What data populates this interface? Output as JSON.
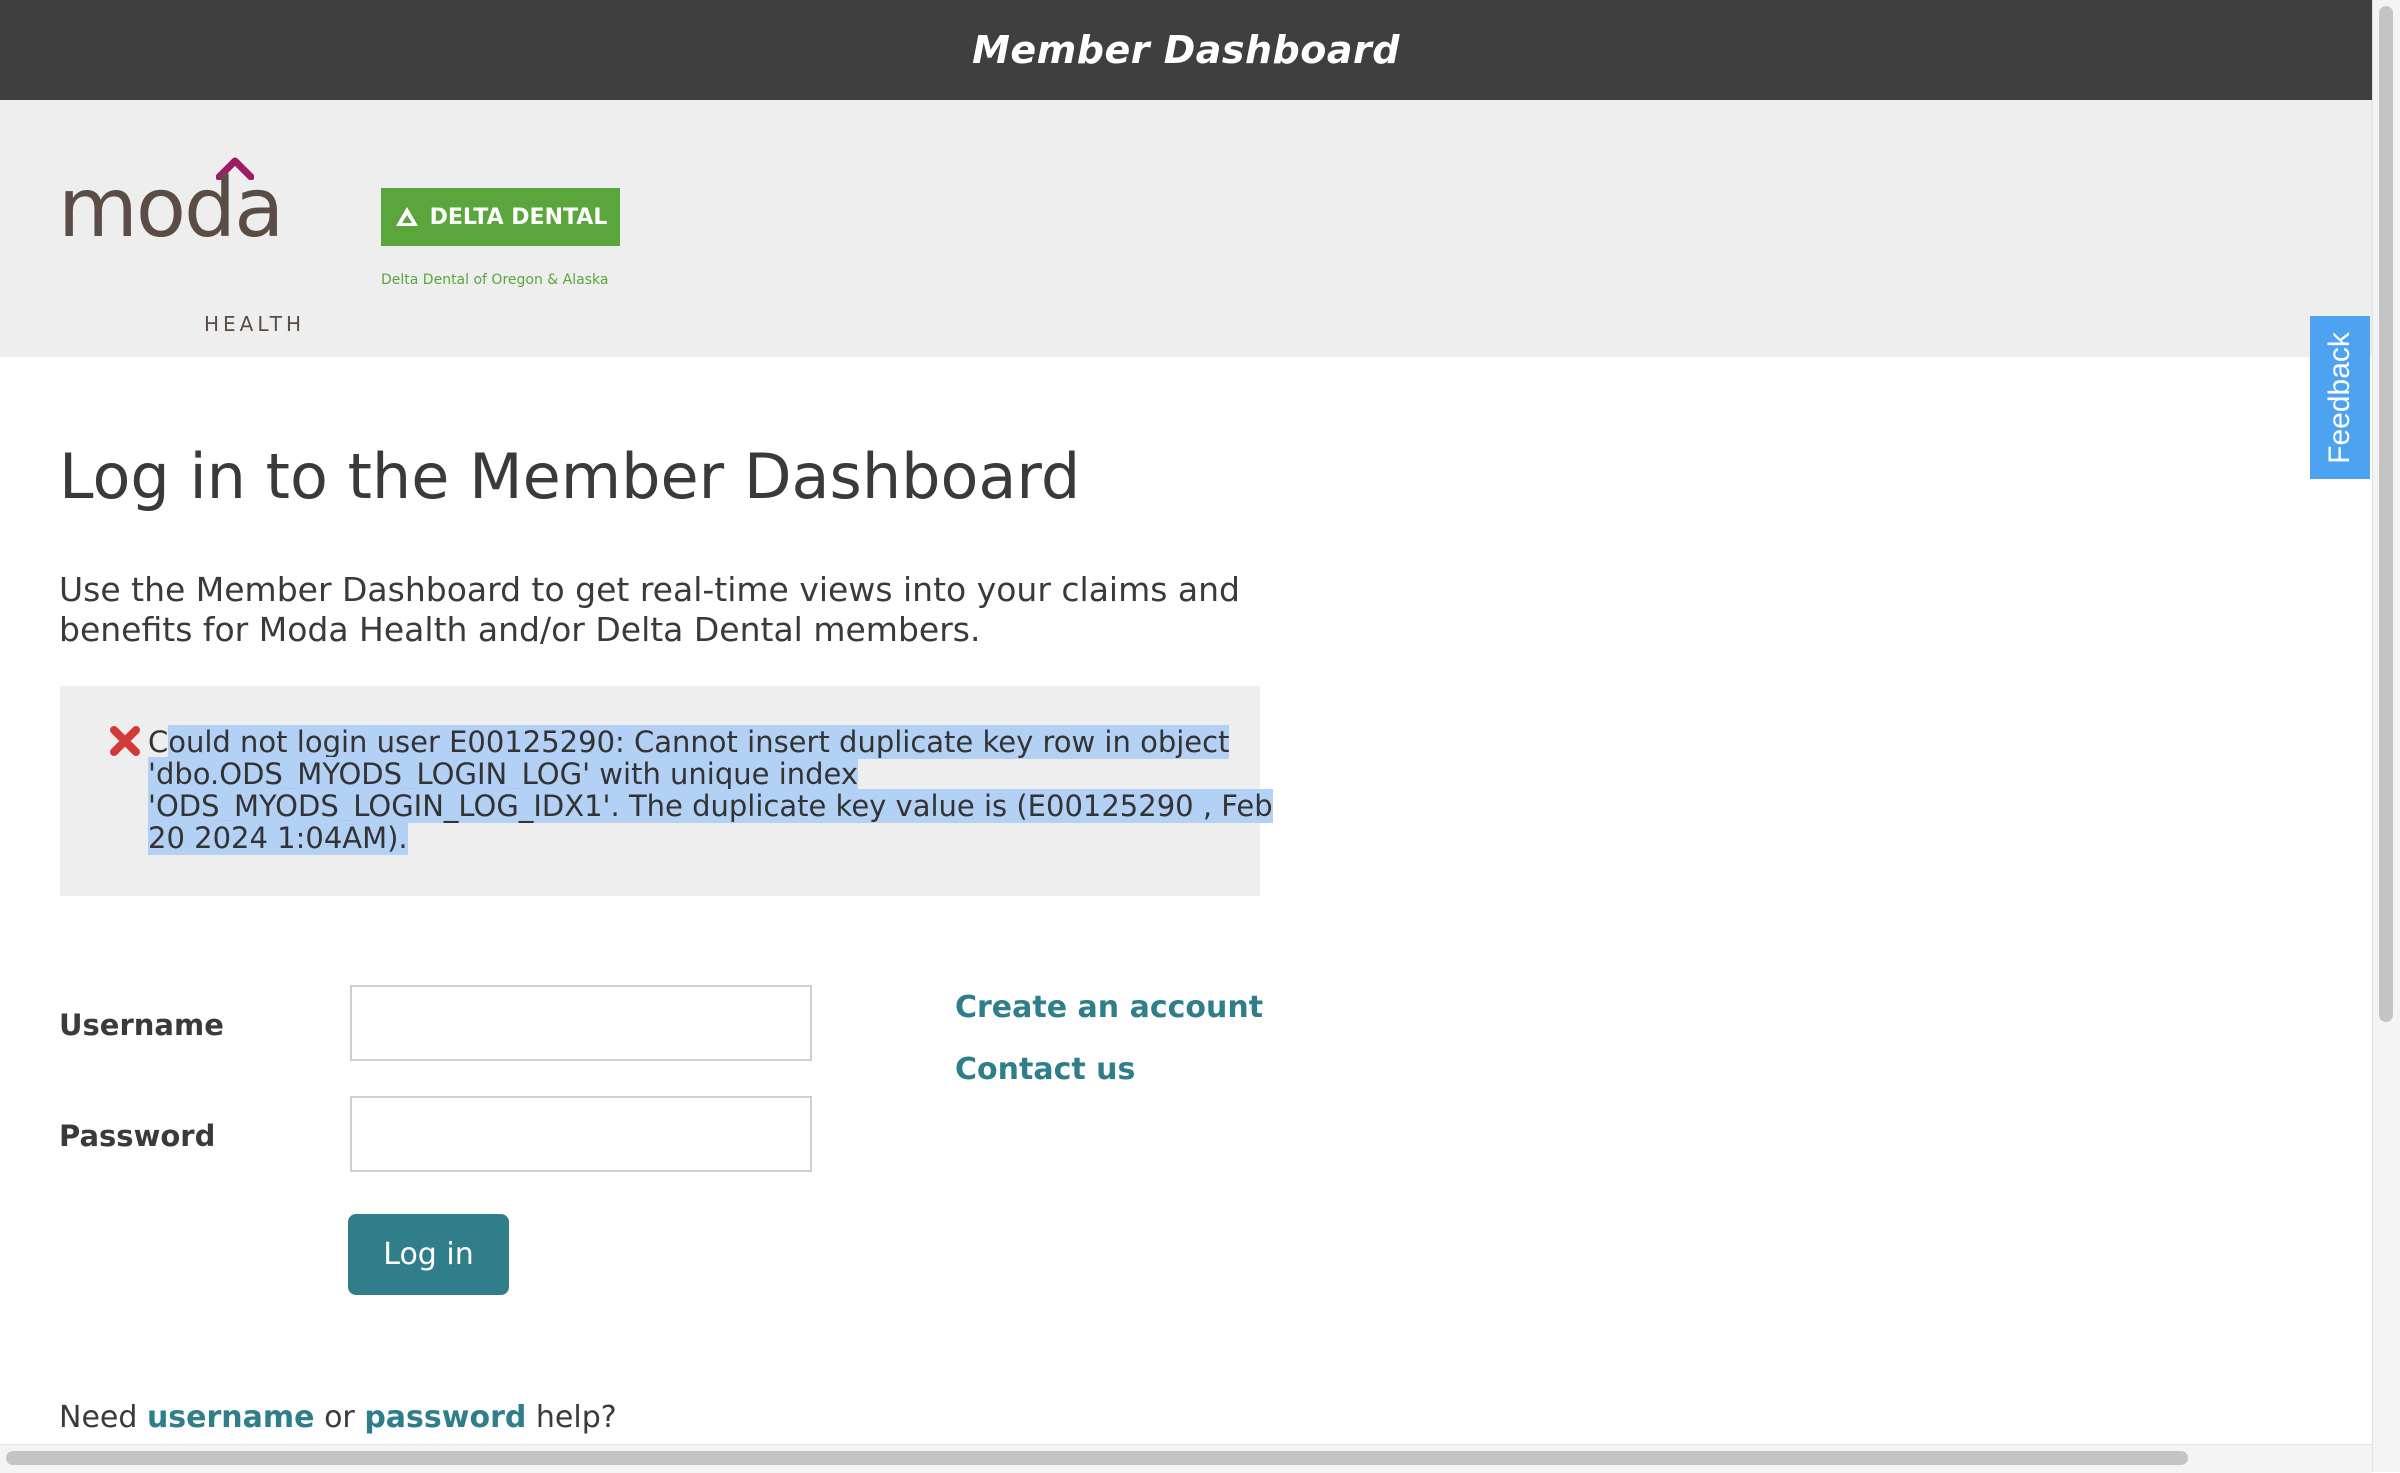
{
  "header": {
    "title": "Member Dashboard"
  },
  "brand": {
    "moda_wordmark": "moda",
    "moda_subtext": "HEALTH",
    "delta_badge": "DELTA DENTAL",
    "delta_tagline": "Delta Dental of Oregon & Alaska",
    "colors": {
      "moda_brown": "#5b4d45",
      "moda_magenta": "#9b1d67",
      "delta_green": "#5aa53c"
    }
  },
  "feedback_tab": {
    "label": "Feedback",
    "color": "#4ea3f0"
  },
  "main": {
    "title": "Log in to the Member Dashboard",
    "intro": "Use the Member Dashboard to get real-time views into your claims and benefits for Moda Health and/or Delta Dental members.",
    "error": {
      "icon": "error-x-icon",
      "first_char": "C",
      "message_selected": "ould not login user E00125290: Cannot insert duplicate key row in object 'dbo.ODS_MYODS_LOGIN_LOG' with unique index 'ODS_MYODS_LOGIN_LOG_IDX1'. The duplicate key value is (E00125290 , Feb 20 2024 1:04AM)."
    },
    "form": {
      "username_label": "Username",
      "username_value": "",
      "password_label": "Password",
      "password_value": "",
      "submit_label": "Log in",
      "accent_color": "#2f7e8a"
    },
    "links": {
      "create_account": "Create an account",
      "contact_us": "Contact us"
    },
    "help": {
      "prefix": "Need",
      "username_link": "username",
      "middle": "or",
      "password_link": "password",
      "suffix": "help?"
    }
  }
}
